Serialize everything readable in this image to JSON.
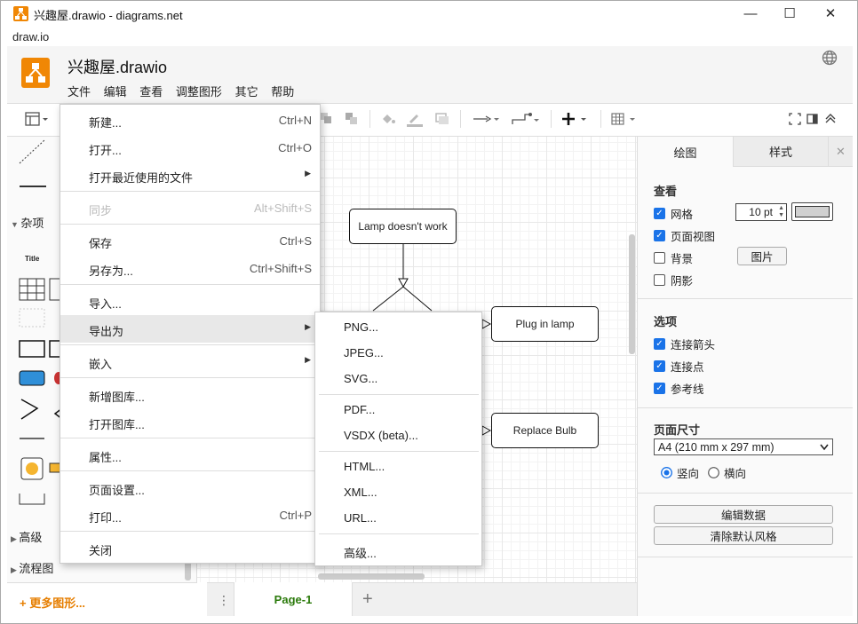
{
  "window": {
    "title": "兴趣屋.drawio - diagrams.net",
    "os_menu": "draw.io",
    "minimize": "—",
    "maximize": "☐",
    "close": "✕"
  },
  "header": {
    "file_title": "兴趣屋.drawio",
    "menu": [
      "文件",
      "编辑",
      "查看",
      "调整图形",
      "其它",
      "帮助"
    ]
  },
  "sidebar": {
    "sections": [
      "杂项",
      "高级",
      "流程图"
    ],
    "shape_title_label": "Title",
    "more_shapes": "+ 更多图形..."
  },
  "canvas": {
    "nodes": [
      "Lamp doesn't work",
      "Plug in lamp",
      "Replace Bulb"
    ]
  },
  "pages": {
    "active": "Page-1",
    "add": "+",
    "more": "⋮"
  },
  "file_menu": {
    "items": [
      {
        "label": "新建...",
        "shortcut": "Ctrl+N"
      },
      {
        "label": "打开...",
        "shortcut": "Ctrl+O"
      },
      {
        "label": "打开最近使用的文件",
        "shortcut": ""
      },
      {
        "label": "同步",
        "shortcut": "Alt+Shift+S"
      },
      {
        "label": "保存",
        "shortcut": "Ctrl+S"
      },
      {
        "label": "另存为...",
        "shortcut": "Ctrl+Shift+S"
      },
      {
        "label": "导入...",
        "shortcut": ""
      },
      {
        "label": "导出为",
        "shortcut": ""
      },
      {
        "label": "嵌入",
        "shortcut": ""
      },
      {
        "label": "新增图库...",
        "shortcut": ""
      },
      {
        "label": "打开图库...",
        "shortcut": ""
      },
      {
        "label": "属性...",
        "shortcut": ""
      },
      {
        "label": "页面设置...",
        "shortcut": ""
      },
      {
        "label": "打印...",
        "shortcut": "Ctrl+P"
      },
      {
        "label": "关闭",
        "shortcut": ""
      }
    ]
  },
  "export_menu": {
    "items": [
      "PNG...",
      "JPEG...",
      "SVG...",
      "PDF...",
      "VSDX (beta)...",
      "HTML...",
      "XML...",
      "URL...",
      "高级..."
    ]
  },
  "format_panel": {
    "tabs": [
      "绘图",
      "样式"
    ],
    "close": "✕",
    "view_title": "查看",
    "view_options": [
      {
        "label": "网格",
        "checked": true
      },
      {
        "label": "页面视图",
        "checked": true
      },
      {
        "label": "背景",
        "checked": false
      },
      {
        "label": "阴影",
        "checked": false
      }
    ],
    "grid_size": "10 pt",
    "image_button": "图片",
    "options_title": "选项",
    "options": [
      {
        "label": "连接箭头",
        "checked": true
      },
      {
        "label": "连接点",
        "checked": true
      },
      {
        "label": "参考线",
        "checked": true
      }
    ],
    "page_size_title": "页面尺寸",
    "page_size_value": "A4 (210 mm x 297 mm)",
    "orientation": [
      {
        "label": "竖向",
        "selected": true
      },
      {
        "label": "横向",
        "selected": false
      }
    ],
    "edit_data_button": "编辑数据",
    "clear_style_button": "清除默认风格"
  },
  "colors": {
    "brand": "#f08705",
    "accent": "#1a73e8",
    "page_tab_text": "#2b7a0b",
    "more_shapes_text": "#e67e00"
  }
}
